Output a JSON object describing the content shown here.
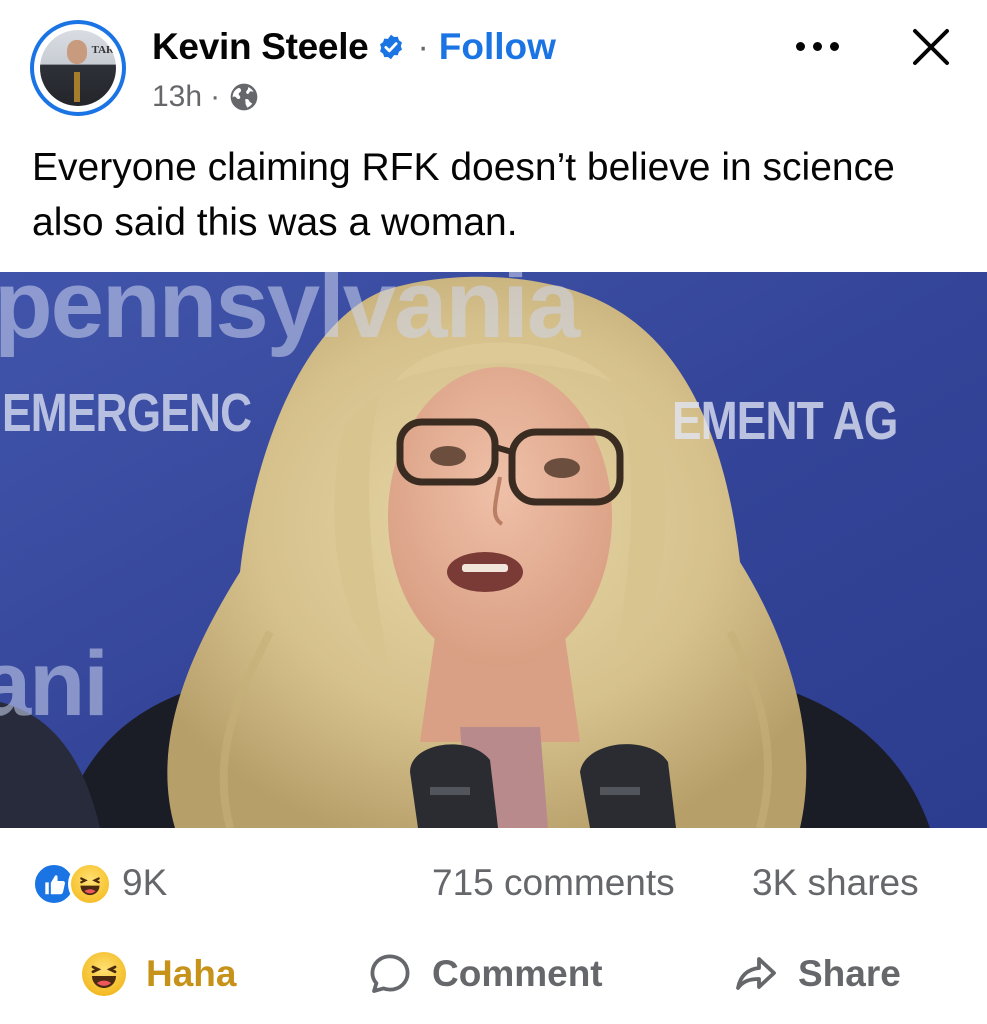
{
  "post": {
    "author": "Kevin Steele",
    "follow_label": "Follow",
    "separator": "·",
    "timestamp": "13h",
    "meta_separator": "·",
    "audience_icon": "globe-icon",
    "verified_icon": "verified-badge-icon",
    "text": "Everyone claiming RFK doesn’t believe in science also said this was a woman.",
    "avatar_sign_text": "TAR",
    "photo": {
      "banner_line_1": "pennsylvania",
      "banner_line_2": "EMERGENC",
      "banner_line_3": "EMENT AG",
      "banner_line_4": "ani"
    }
  },
  "stats": {
    "reactions": [
      "like",
      "haha"
    ],
    "reaction_count": "9K",
    "comments": "715 comments",
    "shares": "3K shares"
  },
  "actions": {
    "haha_label": "Haha",
    "comment_label": "Comment",
    "share_label": "Share"
  },
  "colors": {
    "brand_blue": "#1b74e4",
    "secondary_text": "#65676b",
    "haha_gold": "#c7921a",
    "banner_blue": "#2d3f93"
  }
}
